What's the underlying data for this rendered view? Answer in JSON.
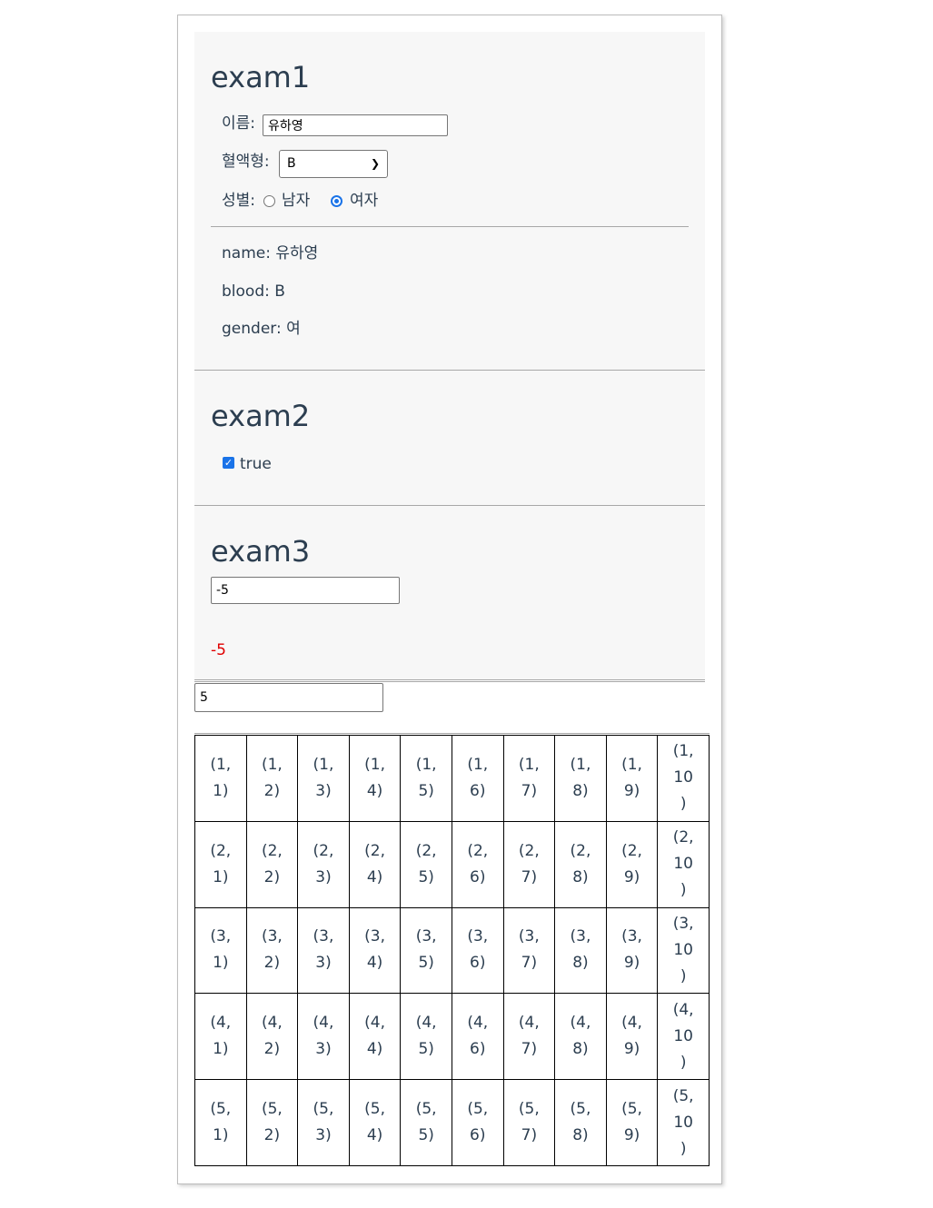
{
  "exam1": {
    "title": "exam1",
    "name_label": "이름:",
    "name_value": "유하영",
    "blood_label": "혈액형:",
    "blood_selected": "B",
    "gender_label": "성별:",
    "gender_options": [
      "남자",
      "여자"
    ],
    "gender_selected": "여자",
    "output_name": "name: 유하영",
    "output_blood": "blood: B",
    "output_gender": "gender: 여"
  },
  "exam2": {
    "title": "exam2",
    "checkbox_checked": true,
    "checkbox_text": "true"
  },
  "exam3": {
    "title": "exam3",
    "input_value": "-5",
    "output_value": "-5",
    "output_color": "#e00000"
  },
  "grid_input": {
    "value": "5"
  },
  "grid": {
    "rows": [
      [
        "(1, 1)",
        "(1, 2)",
        "(1, 3)",
        "(1, 4)",
        "(1, 5)",
        "(1, 6)",
        "(1, 7)",
        "(1, 8)",
        "(1, 9)",
        "(1, 10)"
      ],
      [
        "(2, 1)",
        "(2, 2)",
        "(2, 3)",
        "(2, 4)",
        "(2, 5)",
        "(2, 6)",
        "(2, 7)",
        "(2, 8)",
        "(2, 9)",
        "(2, 10)"
      ],
      [
        "(3, 1)",
        "(3, 2)",
        "(3, 3)",
        "(3, 4)",
        "(3, 5)",
        "(3, 6)",
        "(3, 7)",
        "(3, 8)",
        "(3, 9)",
        "(3, 10)"
      ],
      [
        "(4, 1)",
        "(4, 2)",
        "(4, 3)",
        "(4, 4)",
        "(4, 5)",
        "(4, 6)",
        "(4, 7)",
        "(4, 8)",
        "(4, 9)",
        "(4, 10)"
      ],
      [
        "(5, 1)",
        "(5, 2)",
        "(5, 3)",
        "(5, 4)",
        "(5, 5)",
        "(5, 6)",
        "(5, 7)",
        "(5, 8)",
        "(5, 9)",
        "(5, 10)"
      ]
    ]
  },
  "colors": {
    "text": "#2c3e50",
    "section_bg": "#f7f7f7",
    "accent": "#1a73e8"
  }
}
